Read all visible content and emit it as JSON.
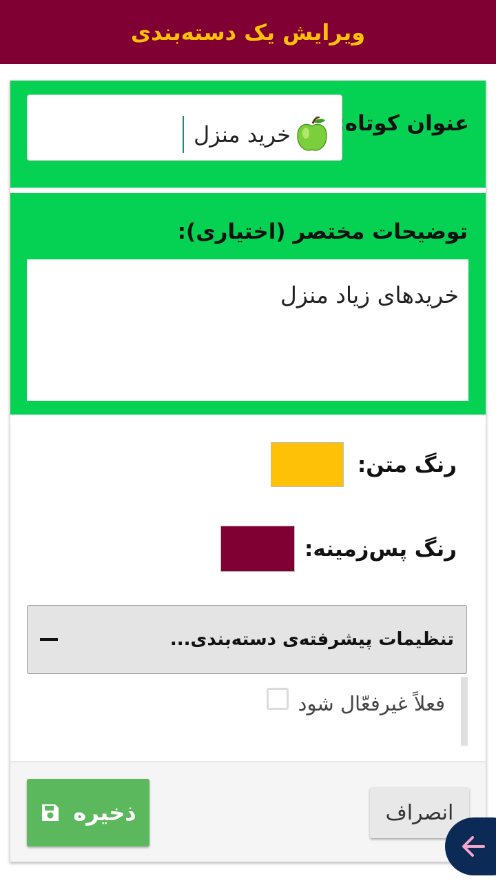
{
  "header": {
    "title": "ویرایش یک دسته‌بندی"
  },
  "form": {
    "short_title_label": "عنوان کوتاه:",
    "short_title_value": "خرید منزل",
    "description_label": "توضیحات مختصر (اختیاری):",
    "description_value": "خریدهای زیاد منزل",
    "text_color_label": "رنگ متن:",
    "text_color": "#FFC107",
    "background_color_label": "رنگ پس‌زمینه:",
    "background_color": "#800033",
    "advanced_label": "تنظیمات پیشرفته‌ی دسته‌بندی...",
    "deactivate_label": "فعلاً غیرفعّال شود",
    "deactivate_checked": false
  },
  "buttons": {
    "save_label": "ذخیره",
    "cancel_label": "انصراف"
  },
  "icons": {
    "title_icon": "green-apple-icon",
    "save_icon": "floppy-disk-icon",
    "collapse_icon": "minus-icon",
    "back_icon": "arrow-left-icon"
  },
  "colors": {
    "header_bg": "#800033",
    "header_text": "#FFC107",
    "section_green": "#05D253",
    "save_button": "#5CB85C",
    "fab": "#0b2a55"
  }
}
